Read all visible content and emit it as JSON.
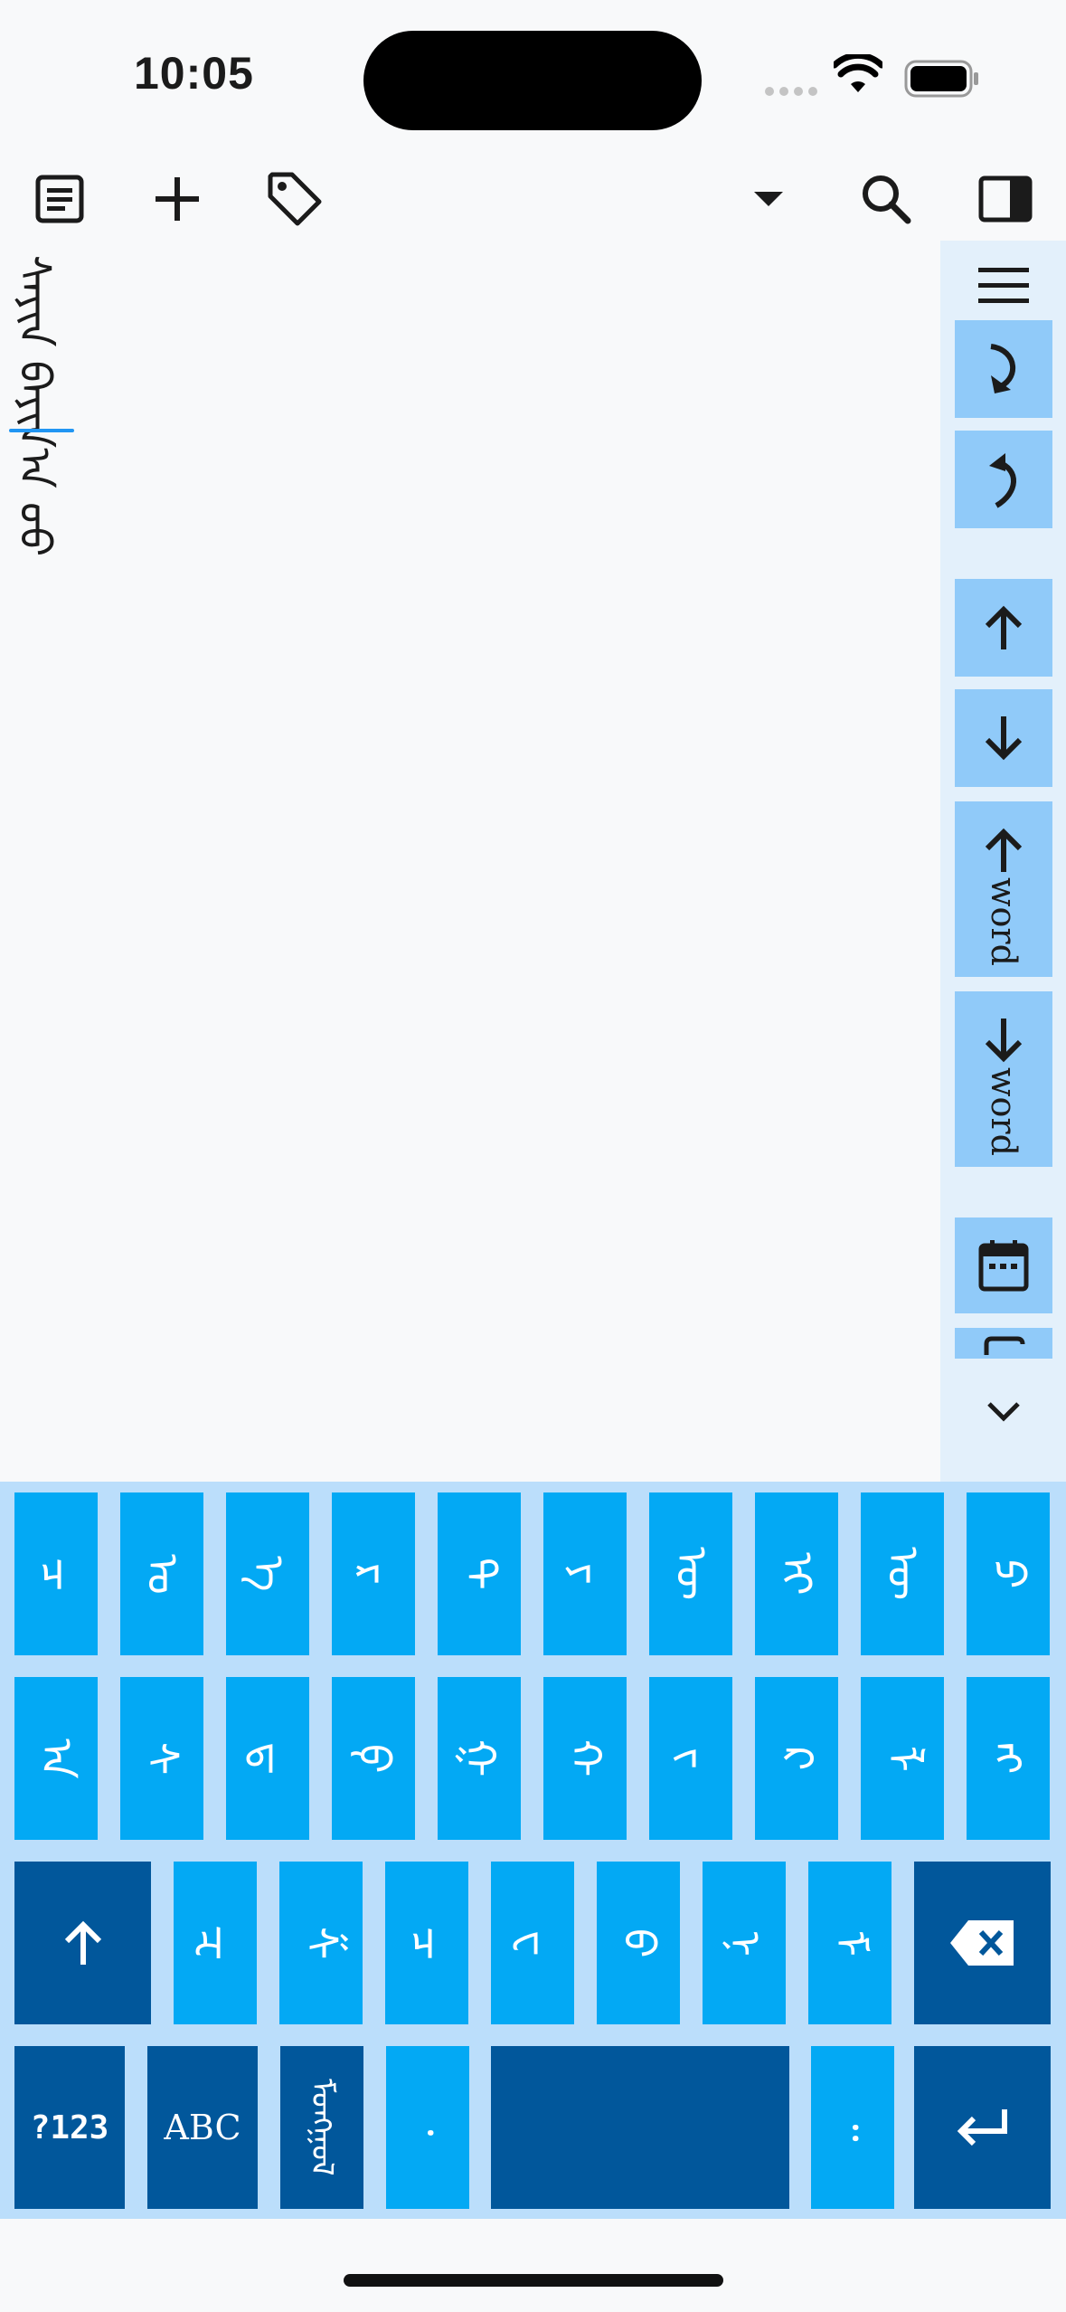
{
  "status_bar": {
    "time": "10:05",
    "icons": [
      "cellular-icon",
      "wifi-icon",
      "battery-icon"
    ]
  },
  "toolbar": {
    "left_icons": [
      "document-icon",
      "add-icon",
      "tag-icon"
    ],
    "right_icons": [
      "dropdown-arrow-icon",
      "search-icon",
      "side-panel-icon"
    ]
  },
  "editor": {
    "text": "ᠰᠠᠶᠢᠨ ᠪᠠᠶᠢᠨ᠎ᠠ ᠤᠤ"
  },
  "side_panel": {
    "buttons": [
      "menu-icon",
      "redo-icon",
      "undo-icon",
      "cursor-up-icon",
      "cursor-down-icon",
      "word-up-icon",
      "word-down-icon",
      "calendar-icon",
      "copy-icon",
      "collapse-chevron-icon"
    ],
    "word_up_label": "word",
    "word_down_label": "word"
  },
  "keyboard": {
    "row1": [
      "ᠴ",
      "ᠣ",
      "ᠡ",
      "ᠷ",
      "ᠲ",
      "ᠶ",
      "ᠦ",
      "ᠢ",
      "ᠥ",
      "ᠫ"
    ],
    "row2": [
      "ᠠ",
      "ᠰ",
      "ᠳ",
      "ᠹ",
      "ᠭ",
      "ᠬ",
      "ᠵ",
      "ᠺ",
      "ᠯ",
      "ᠩ"
    ],
    "row3": [
      "ᠽ",
      "ᠱ",
      "ᠴ",
      "ᠸ",
      "ᠪ",
      "ᠨ",
      "ᠮ"
    ],
    "bottom": {
      "numbers_label": "?123",
      "abc_label": "ABC",
      "mongol_label": "ᠮᠣᠩᠭᠣᠯ",
      "comma": "᠂",
      "period": "᠃"
    },
    "shift_icon": "shift-arrow-icon",
    "backspace_icon": "backspace-icon",
    "enter_icon": "enter-icon"
  },
  "colors": {
    "key_light": "#03a9f4",
    "key_dark": "#01579b",
    "keyboard_bg": "#bbdefb",
    "panel_btn": "#90caf9",
    "panel_bg": "#e3f0fb",
    "cursor": "#2196f3"
  }
}
